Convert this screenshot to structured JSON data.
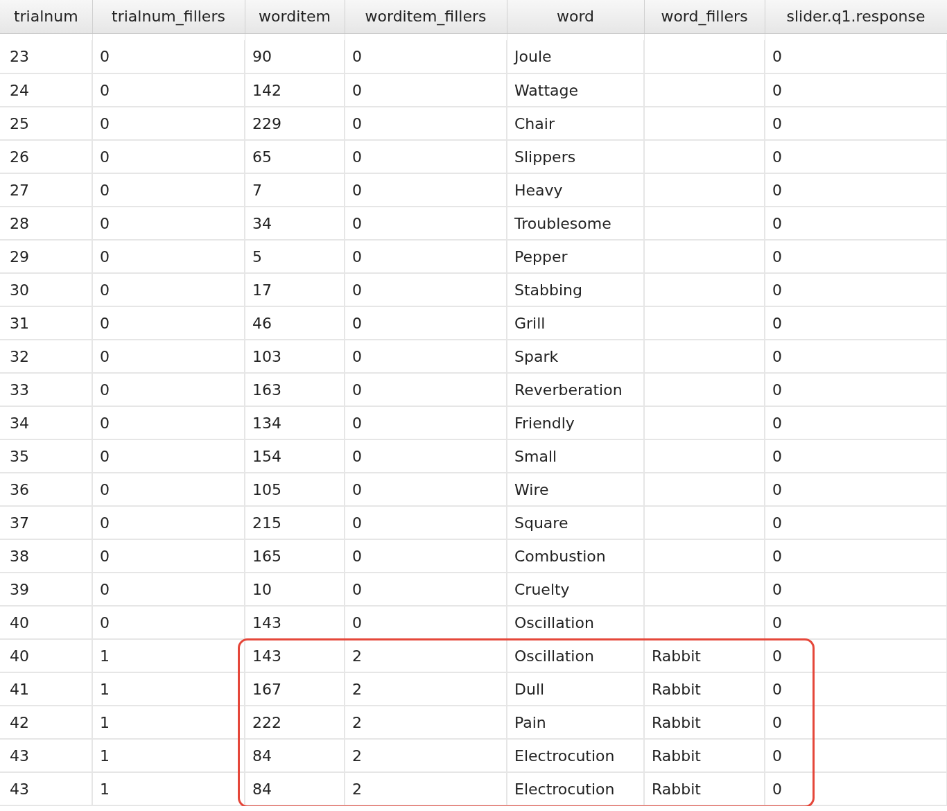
{
  "table": {
    "columns": [
      "trialnum",
      "trialnum_fillers",
      "worditem",
      "worditem_fillers",
      "word",
      "word_fillers",
      "slider.q1.response"
    ],
    "rows": [
      {
        "cells": [
          "23",
          "0",
          "90",
          "0",
          "Joule",
          "",
          "0"
        ],
        "highlighted": false
      },
      {
        "cells": [
          "24",
          "0",
          "142",
          "0",
          "Wattage",
          "",
          "0"
        ],
        "highlighted": false
      },
      {
        "cells": [
          "25",
          "0",
          "229",
          "0",
          "Chair",
          "",
          "0"
        ],
        "highlighted": false
      },
      {
        "cells": [
          "26",
          "0",
          "65",
          "0",
          "Slippers",
          "",
          "0"
        ],
        "highlighted": false
      },
      {
        "cells": [
          "27",
          "0",
          "7",
          "0",
          "Heavy",
          "",
          "0"
        ],
        "highlighted": false
      },
      {
        "cells": [
          "28",
          "0",
          "34",
          "0",
          "Troublesome",
          "",
          "0"
        ],
        "highlighted": false
      },
      {
        "cells": [
          "29",
          "0",
          "5",
          "0",
          "Pepper",
          "",
          "0"
        ],
        "highlighted": false
      },
      {
        "cells": [
          "30",
          "0",
          "17",
          "0",
          "Stabbing",
          "",
          "0"
        ],
        "highlighted": false
      },
      {
        "cells": [
          "31",
          "0",
          "46",
          "0",
          "Grill",
          "",
          "0"
        ],
        "highlighted": false
      },
      {
        "cells": [
          "32",
          "0",
          "103",
          "0",
          "Spark",
          "",
          "0"
        ],
        "highlighted": false
      },
      {
        "cells": [
          "33",
          "0",
          "163",
          "0",
          "Reverberation",
          "",
          "0"
        ],
        "highlighted": false
      },
      {
        "cells": [
          "34",
          "0",
          "134",
          "0",
          "Friendly",
          "",
          "0"
        ],
        "highlighted": false
      },
      {
        "cells": [
          "35",
          "0",
          "154",
          "0",
          "Small",
          "",
          "0"
        ],
        "highlighted": false
      },
      {
        "cells": [
          "36",
          "0",
          "105",
          "0",
          "Wire",
          "",
          "0"
        ],
        "highlighted": false
      },
      {
        "cells": [
          "37",
          "0",
          "215",
          "0",
          "Square",
          "",
          "0"
        ],
        "highlighted": false
      },
      {
        "cells": [
          "38",
          "0",
          "165",
          "0",
          "Combustion",
          "",
          "0"
        ],
        "highlighted": false
      },
      {
        "cells": [
          "39",
          "0",
          "10",
          "0",
          "Cruelty",
          "",
          "0"
        ],
        "highlighted": false
      },
      {
        "cells": [
          "40",
          "0",
          "143",
          "0",
          "Oscillation",
          "",
          "0"
        ],
        "highlighted": false
      },
      {
        "cells": [
          "40",
          "1",
          "143",
          "2",
          "Oscillation",
          "Rabbit",
          "0"
        ],
        "highlighted": true
      },
      {
        "cells": [
          "41",
          "1",
          "167",
          "2",
          "Dull",
          "Rabbit",
          "0"
        ],
        "highlighted": true
      },
      {
        "cells": [
          "42",
          "1",
          "222",
          "2",
          "Pain",
          "Rabbit",
          "0"
        ],
        "highlighted": true
      },
      {
        "cells": [
          "43",
          "1",
          "84",
          "2",
          "Electrocution",
          "Rabbit",
          "0"
        ],
        "highlighted": true
      },
      {
        "cells": [
          "43",
          "1",
          "84",
          "2",
          "Electrocution",
          "Rabbit",
          "0"
        ],
        "highlighted": true
      }
    ]
  }
}
